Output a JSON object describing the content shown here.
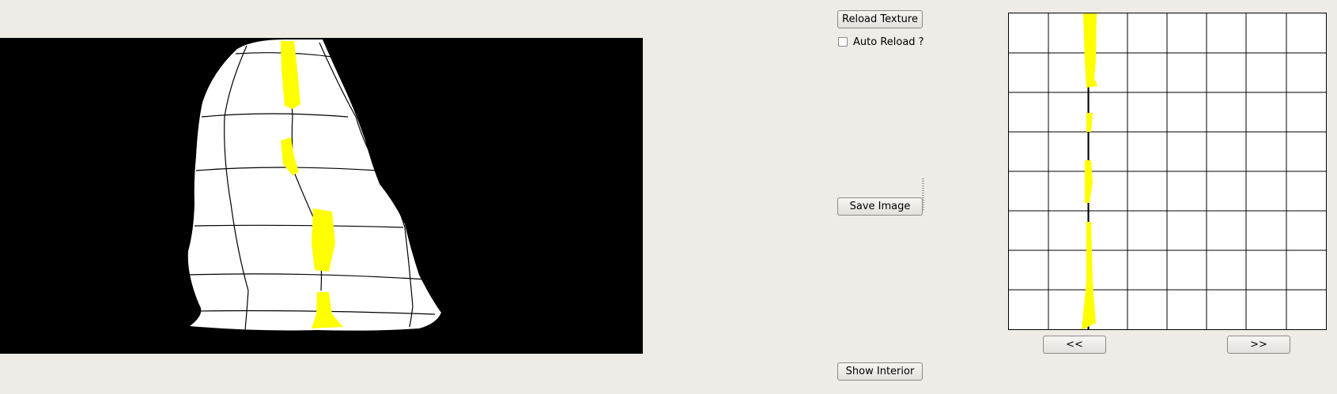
{
  "toolbar": {
    "reload_texture_label": "Reload Texture",
    "auto_reload_label": "Auto Reload ?",
    "auto_reload_checked": false,
    "save_image_label": "Save Image",
    "show_interior_label": "Show Interior"
  },
  "texture_nav": {
    "prev_label": "<<",
    "next_label": ">>"
  },
  "colors": {
    "window_bg": "#efebe7",
    "viewport_bg": "#000000",
    "mesh_fill": "#ffffff",
    "stroke_highlight": "#ffff00",
    "grid_line": "#000000"
  },
  "texture_grid": {
    "columns": 8,
    "rows": 8
  }
}
